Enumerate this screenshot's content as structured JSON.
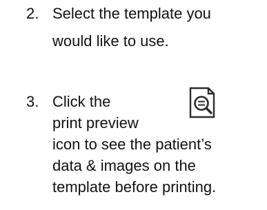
{
  "steps": [
    {
      "number": "2.",
      "lines": [
        "Select the template you",
        "would like to use."
      ]
    },
    {
      "number": "3.",
      "lines": [
        "Click the",
        "print preview",
        "icon to see the patient’s",
        "data & images on the",
        "template before printing."
      ],
      "icon": "print-preview-icon"
    }
  ]
}
